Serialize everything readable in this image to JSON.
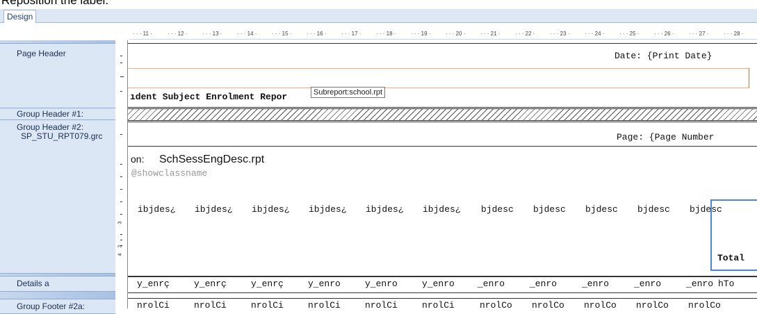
{
  "caption": "Reposition the label.",
  "tab": {
    "label": "Design"
  },
  "ruler": {
    "marks": [
      "11",
      "12",
      "13",
      "14",
      "15",
      "16",
      "17",
      "18",
      "19",
      "20",
      "21",
      "22",
      "23",
      "24",
      "25",
      "26",
      "27",
      "28"
    ]
  },
  "sections": {
    "page_header": "Page Header",
    "group_header_1": "Group Header #1:",
    "group_header_2": "Group Header #2:",
    "group_header_2_name": "SP_STU_RPT079.grc",
    "details": "Details a",
    "group_footer": "Group Footer #2a:"
  },
  "vruler": {
    "n2": "2",
    "n3": "3",
    "n4": "4"
  },
  "fields": {
    "print_date": "Date: {Print Date}",
    "report_title": "ıdent Subject Enrolment Repor",
    "page_number": "Page: {Page Number",
    "on_label": "on:",
    "subreport_name": "SchSessEngDesc.rpt",
    "show_class": "@showclassname",
    "total": "Total",
    "subj_desc": [
      "ibjdes¿",
      "ibjdes¿",
      "ibjdes¿",
      "ibjdes¿",
      "ibjdes¿",
      "ibjdes¿",
      "bjdesc",
      "bjdesc",
      "bjdesc",
      "bjdesc",
      "bjdesc"
    ],
    "details_fields": [
      "y_enrç",
      "y_enrç",
      "y_enrç",
      "y_enro",
      "y_enro",
      "y_enro",
      "_enro",
      "_enro",
      "_enro",
      "_enro",
      "_enro",
      "hTo"
    ],
    "footer_fields": [
      "nrolCi",
      "nrolCi",
      "nrolCi",
      "nrolCi",
      "nrolCi",
      "nrolCi",
      "nrolCo",
      "nrolCo",
      "nrolCo",
      "nrolCo",
      "nrolCo"
    ]
  },
  "tooltip": "Subreport:school.rpt"
}
